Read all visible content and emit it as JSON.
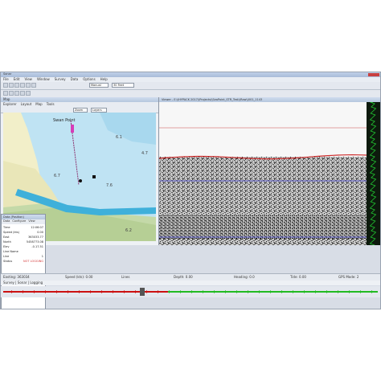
{
  "app": {
    "title": "Sonar",
    "menu": [
      "File",
      "Edit",
      "View",
      "Window",
      "Survey",
      "Data",
      "Options",
      "Help"
    ],
    "range_combo": "Manual",
    "depth_combo": "30 Feet"
  },
  "map": {
    "title": "Map",
    "tabs": [
      "Explorer",
      "Layout",
      "Map",
      "Tools"
    ],
    "toolbar_combo_a": "Zoom",
    "toolbar_combo_b": "Layers",
    "place_label": "Swan Point",
    "soundings": [
      "6.1",
      "4.7",
      "6.7",
      "7.6",
      "6.2"
    ]
  },
  "data_panel": {
    "title": "Data (Position)",
    "tabs": [
      "Data",
      "Configure",
      "View"
    ],
    "rows": [
      {
        "key": "Time",
        "value": "12:06:07"
      },
      {
        "key": "Speed (kts)",
        "value": "0.00"
      },
      {
        "key": "East",
        "value": "363033.77"
      },
      {
        "key": "North",
        "value": "5458773.08"
      },
      {
        "key": "Elev",
        "value": "-0.17.51"
      },
      {
        "key": "Line Name",
        "value": ""
      },
      {
        "key": "Line",
        "value": "1"
      },
      {
        "key": "Status",
        "value": ""
      }
    ],
    "status_badge": "NOT LOGGING"
  },
  "sonar": {
    "title": "Viewer - E:\\\\HYPACK 2017\\\\Projects\\\\SeaPoint_STR_Test\\\\Raw\\\\001_1143",
    "colors": {
      "surface": "#e0a0a0",
      "bottom": "#cc2b2b",
      "depth": "#3a3acc",
      "trace": "#22cc33"
    }
  },
  "status_bar": {
    "items": [
      "Easting: 363034",
      "Speed (kts): 0.00",
      "Lines",
      "Depth: 0.00",
      "Heading: 0.0",
      "Tide: 0.00",
      "GPS Mode: 2"
    ],
    "bottom_text": "Survey  |  Sonar  |  Logging"
  },
  "playback": {
    "progress": 0.44,
    "played_color": "#cc1111",
    "remaining_color": "#22bb22"
  }
}
